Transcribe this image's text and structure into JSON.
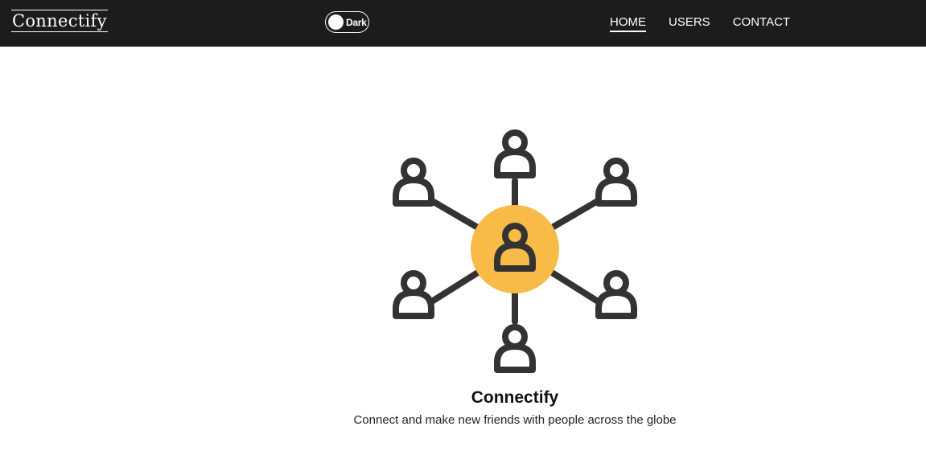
{
  "brand": {
    "logo_text": "Connectify"
  },
  "theme_toggle": {
    "label": "Dark"
  },
  "nav": {
    "items": [
      {
        "label": "HOME",
        "active": true
      },
      {
        "label": "USERS",
        "active": false
      },
      {
        "label": "CONTACT",
        "active": false
      }
    ]
  },
  "hero": {
    "illustration_icon": "network-people-icon",
    "title": "Connectify",
    "subtitle": "Connect and make new friends with people across the globe"
  },
  "colors": {
    "navbar_bg": "#1c1c1c",
    "accent": "#f9bb47",
    "icon_stroke": "#333333",
    "page_bg": "#ffffff"
  }
}
